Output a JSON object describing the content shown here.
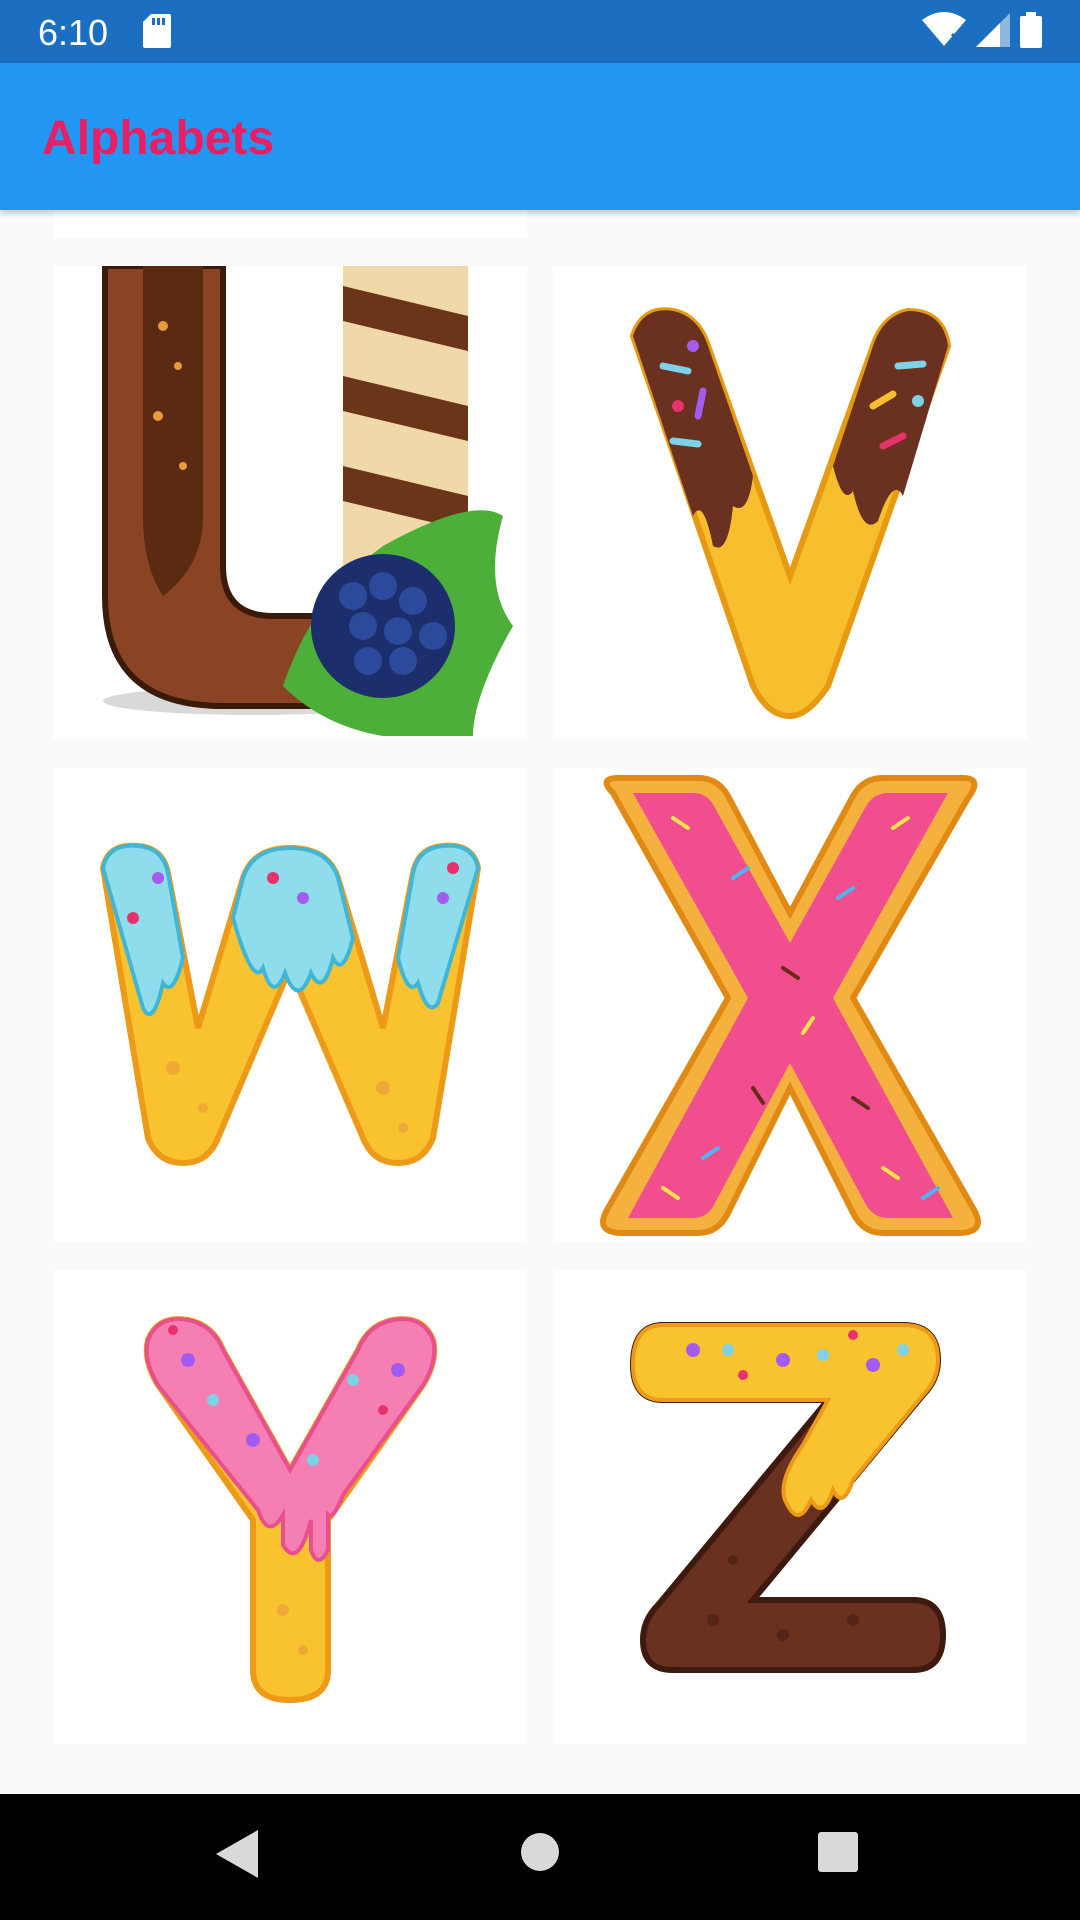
{
  "status_bar": {
    "time": "6:10",
    "icons": [
      "sd-card-icon",
      "wifi-icon",
      "cell-signal-icon",
      "battery-icon"
    ]
  },
  "app_bar": {
    "title": "Alphabets",
    "background": "#2196f3",
    "title_color": "#e91e63"
  },
  "grid": {
    "items": [
      {
        "letter": "U",
        "style": "chocolate-wafer-blackberry"
      },
      {
        "letter": "V",
        "style": "chocolate-drip-waffle-cone"
      },
      {
        "letter": "W",
        "style": "blue-icing-donut"
      },
      {
        "letter": "X",
        "style": "pink-sprinkle-cookie"
      },
      {
        "letter": "Y",
        "style": "pink-icing-donut"
      },
      {
        "letter": "Z",
        "style": "yellow-icing-chocolate"
      }
    ]
  },
  "nav_bar": {
    "buttons": [
      "back-icon",
      "home-icon",
      "recents-icon"
    ]
  }
}
